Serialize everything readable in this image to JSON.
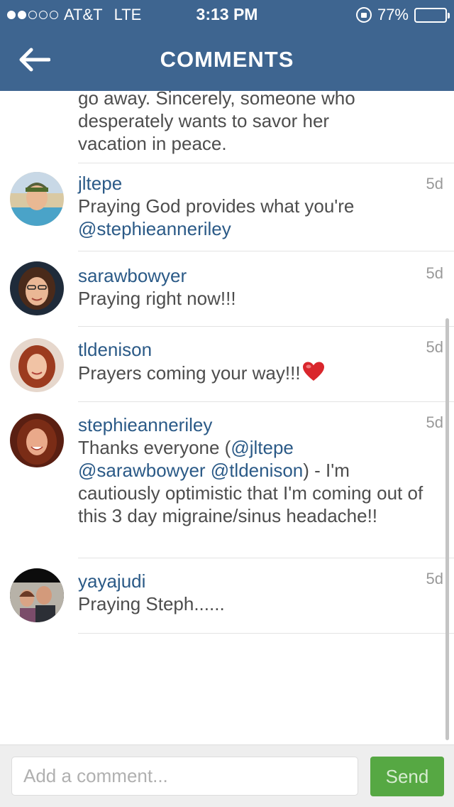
{
  "status_bar": {
    "carrier": "AT&T",
    "network": "LTE",
    "time": "3:13 PM",
    "battery": "77%",
    "battery_fraction": 0.77,
    "signal_bars_filled": 2,
    "signal_bars_total": 5
  },
  "header": {
    "title": "COMMENTS",
    "back_icon": "arrow-left-icon"
  },
  "colors": {
    "header_bg": "#3e6590",
    "link": "#2b5a87",
    "send_button": "#56a843"
  },
  "previous_comment": {
    "lines": [
      "go away. Sincerely, someone who",
      "desperately wants to savor her",
      "vacation in peace."
    ]
  },
  "comments": [
    {
      "username": "jltepe",
      "text": "Praying God provides what you're",
      "mention": "@stephieanneriley",
      "time": "5d"
    },
    {
      "username": "sarawbowyer",
      "text": "Praying right now!!!",
      "time": "5d"
    },
    {
      "username": "tldenison",
      "text": "Prayers coming your way!!!",
      "emoji": "heart-icon",
      "time": "5d"
    },
    {
      "username": "stephieanneriley",
      "text_prefix": "Thanks everyone (",
      "mention_1": "@jltepe",
      "mention_2": "@sarawbowyer",
      "mention_3": "@tldenison",
      "text_suffix": ") - I'm cautiously optimistic that I'm coming out of this 3 day migraine/sinus headache!!",
      "time": "5d"
    },
    {
      "username": "yayajudi",
      "text": "Praying Steph......",
      "time": "5d"
    }
  ],
  "composer": {
    "placeholder": "Add a comment...",
    "send_label": "Send"
  }
}
